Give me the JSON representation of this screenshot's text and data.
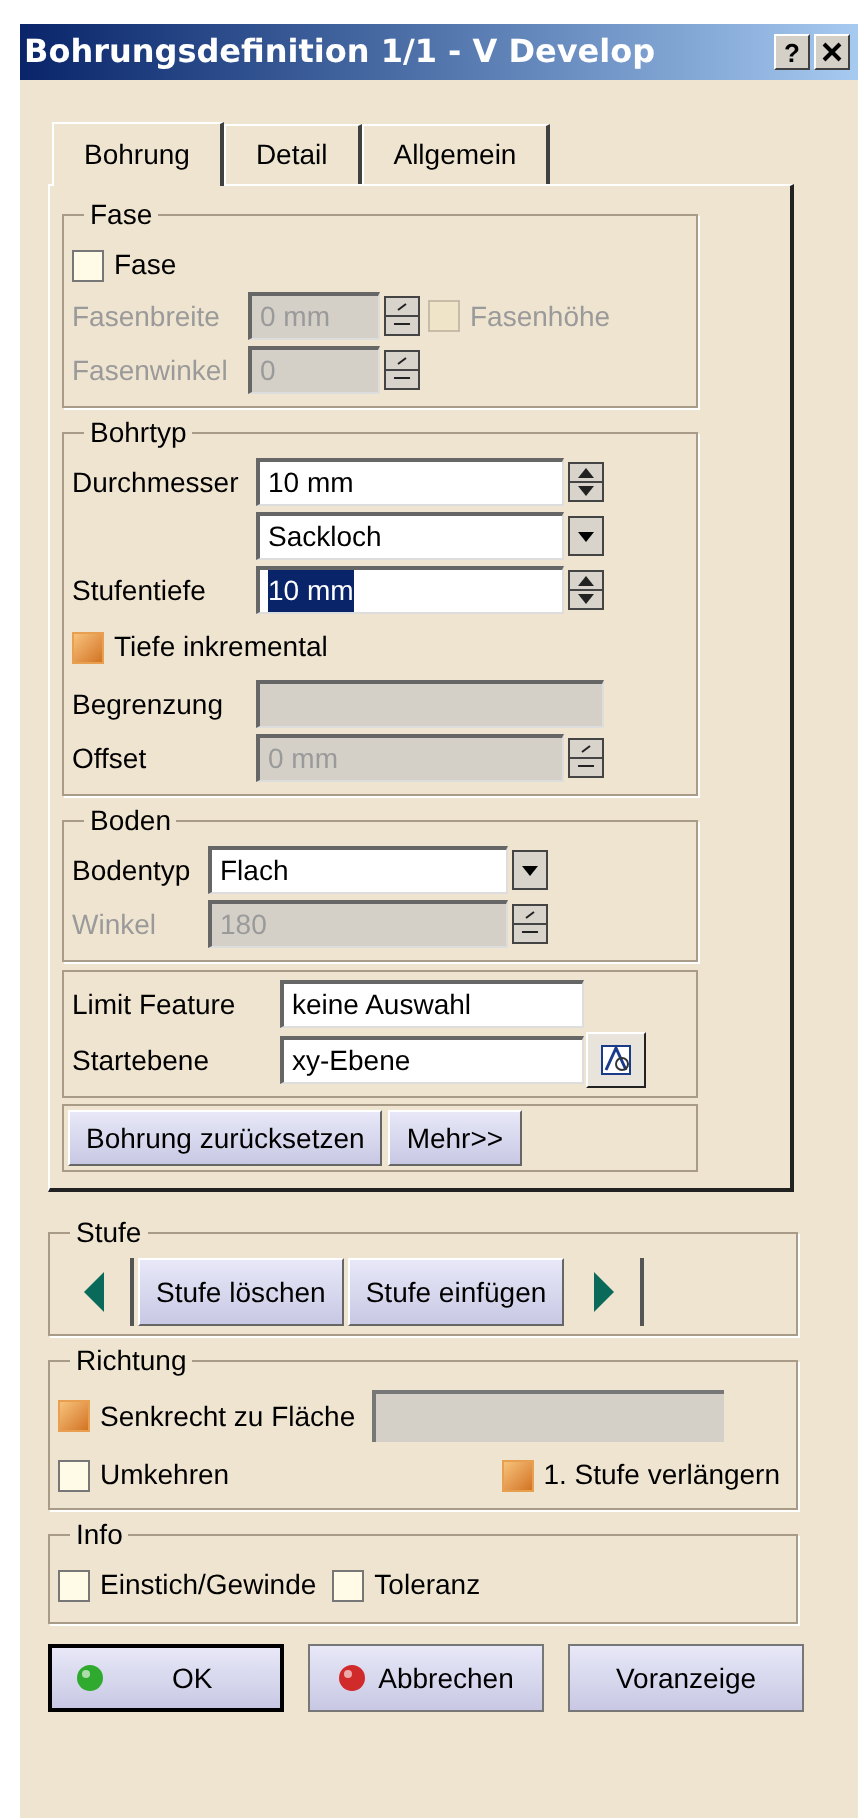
{
  "window": {
    "title": "Bohrungsdefinition 1/1 - V Develop",
    "help_button": "?"
  },
  "tabs": [
    {
      "label": "Bohrung",
      "selected": true
    },
    {
      "label": "Detail",
      "selected": false
    },
    {
      "label": "Allgemein",
      "selected": false
    }
  ],
  "chamfer": {
    "legend": "Fase",
    "enable": {
      "label": "Fase",
      "checked": false
    },
    "width": {
      "label": "Fasenbreite",
      "value": "0 mm",
      "disabled": true
    },
    "height_option": {
      "label": "Fasenhöhe",
      "checked": false,
      "disabled": true
    },
    "angle": {
      "label": "Fasenwinkel",
      "value": "0",
      "disabled": true
    }
  },
  "hole_type": {
    "legend": "Bohrtyp",
    "diameter": {
      "label": "Durchmesser",
      "value": "10 mm",
      "disabled": false
    },
    "type": {
      "value": "Sackloch"
    },
    "depth": {
      "label": "Stufentiefe",
      "value": "10 mm",
      "selected": true,
      "disabled": false
    },
    "incremental": {
      "label": "Tiefe inkremental",
      "checked": true
    },
    "limit": {
      "label": "Begrenzung",
      "disabled": true
    },
    "offset": {
      "label": "Offset",
      "value": "0 mm",
      "disabled": true
    }
  },
  "bottom": {
    "legend": "Boden",
    "type": {
      "label": "Bodentyp",
      "value": "Flach"
    },
    "angle": {
      "label": "Winkel",
      "value": "180",
      "disabled": true
    }
  },
  "references": {
    "limit_feature": {
      "label": "Limit Feature",
      "value": "keine Auswahl"
    },
    "start_plane": {
      "label": "Startebene",
      "value": "xy-Ebene"
    }
  },
  "panel_buttons": [
    "Bohrung zurücksetzen",
    "Mehr>>"
  ],
  "step": {
    "legend": "Stufe",
    "buttons": [
      "Stufe löschen",
      "Stufe einfügen"
    ]
  },
  "direction": {
    "legend": "Richtung",
    "normal": {
      "label": "Senkrecht zu Fläche",
      "checked": true
    },
    "reverse": {
      "label": "Umkehren",
      "checked": false
    },
    "extend": {
      "label": "1. Stufe verlängern",
      "checked": true
    }
  },
  "info": {
    "legend": "Info",
    "options": [
      {
        "label": "Einstich/Gewinde",
        "checked": false
      },
      {
        "label": "Toleranz",
        "checked": false
      }
    ]
  },
  "dialog_buttons": [
    {
      "label": "OK",
      "kind": "ok"
    },
    {
      "label": "Abbrechen",
      "kind": "cancel"
    },
    {
      "label": "Voranzeige",
      "kind": "plain"
    }
  ]
}
